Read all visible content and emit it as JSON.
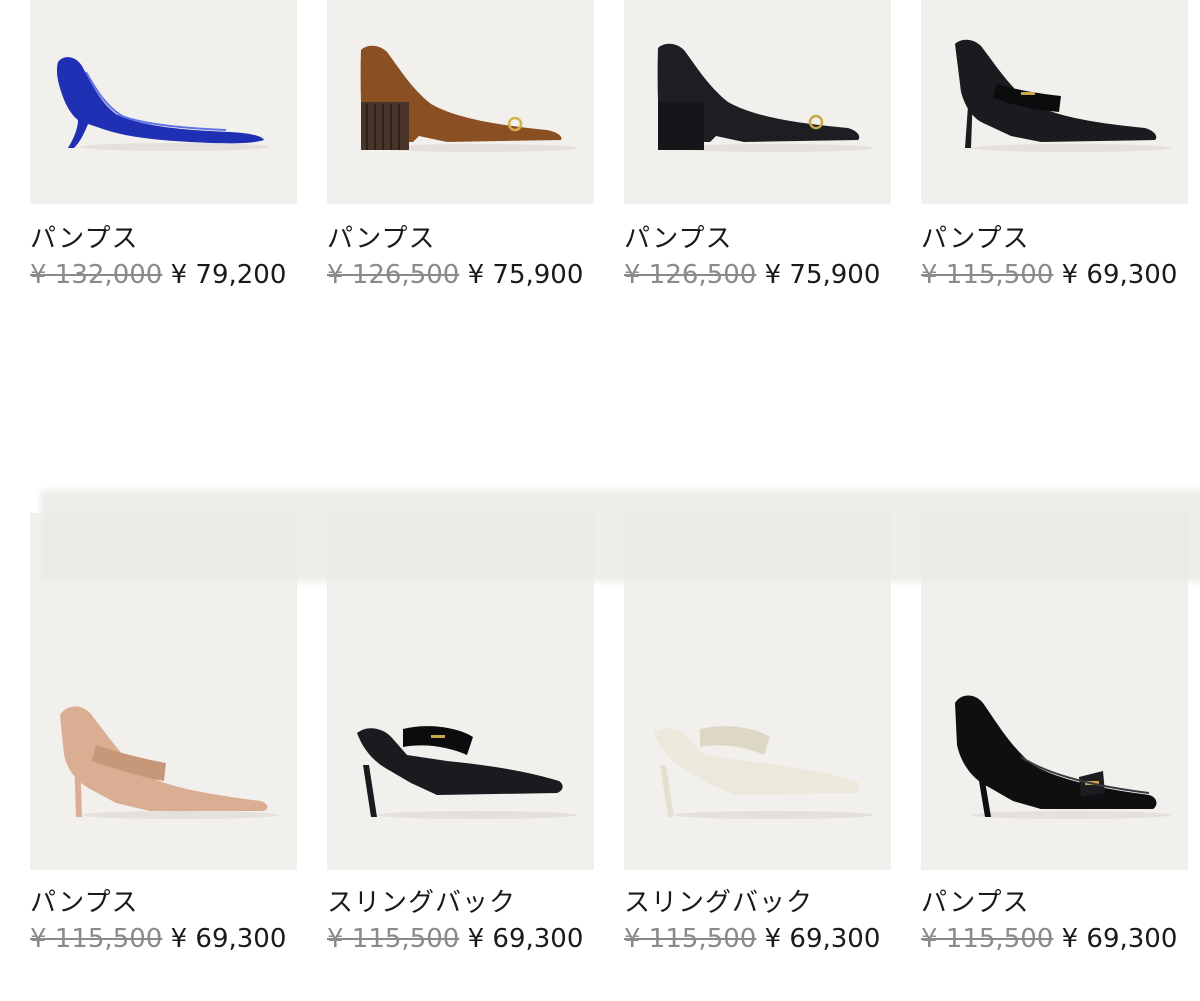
{
  "colors": {
    "image_background": "#f2f0ed",
    "original_price": "#8a8a8a",
    "sale_price": "#1a1a1a"
  },
  "products": [
    {
      "name": "パンプス",
      "price_original": "¥ 132,000",
      "price_sale": "¥ 79,200",
      "image_icon": "blue-patent-kitten-heel-pump-icon"
    },
    {
      "name": "パンプス",
      "price_original": "¥ 126,500",
      "price_sale": "¥ 75,900",
      "image_icon": "brown-block-heel-pump-icon"
    },
    {
      "name": "パンプス",
      "price_original": "¥ 126,500",
      "price_sale": "¥ 75,900",
      "image_icon": "black-block-heel-pump-icon"
    },
    {
      "name": "パンプス",
      "price_original": "¥ 115,500",
      "price_sale": "¥ 69,300",
      "image_icon": "black-pointed-pump-icon"
    },
    {
      "name": "パンプス",
      "price_original": "¥ 115,500",
      "price_sale": "¥ 69,300",
      "image_icon": "nude-pointed-pump-icon"
    },
    {
      "name": "スリングバック",
      "price_original": "¥ 115,500",
      "price_sale": "¥ 69,300",
      "image_icon": "black-slingback-icon"
    },
    {
      "name": "スリングバック",
      "price_original": "¥ 115,500",
      "price_sale": "¥ 69,300",
      "image_icon": "white-slingback-icon"
    },
    {
      "name": "パンプス",
      "price_original": "¥ 115,500",
      "price_sale": "¥ 69,300",
      "image_icon": "black-patent-bow-pump-icon"
    }
  ]
}
